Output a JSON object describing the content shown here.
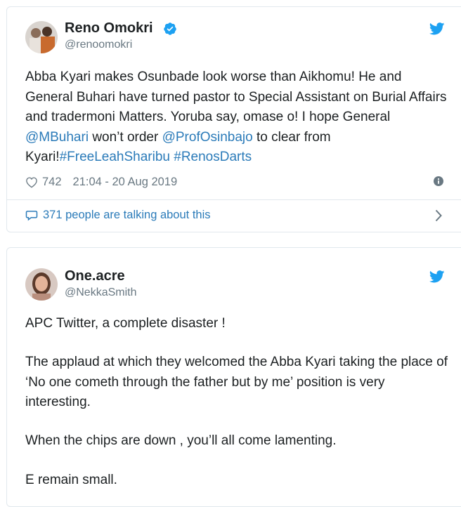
{
  "tweet1": {
    "display_name": "Reno Omokri",
    "handle": "@renoomokri",
    "text_parts": {
      "a": "Abba Kyari makes Osunbade look worse than Aikhomu! He and General Buhari have turned pastor to Special Assistant on Burial Affairs and tradermoni Matters. Yoruba say, omase o! I hope General ",
      "mention1": "@MBuhari",
      "b": " won’t order ",
      "mention2": "@ProfOsinbajo",
      "c": " to clear from Kyari!",
      "tag1": "#FreeLeahSharibu",
      "space": " ",
      "tag2": "#RenosDarts"
    },
    "likes": "742",
    "timestamp": "21:04 - 20 Aug 2019",
    "talking": "371 people are talking about this"
  },
  "tweet2": {
    "display_name": "One.acre",
    "handle": "@NekkaSmith",
    "paragraphs": [
      "APC Twitter, a complete disaster !",
      "The applaud at which they welcomed the Abba Kyari taking the place of ‘No one cometh through the father but by me’ position is very interesting.",
      "When the chips are down , you’ll all come lamenting.",
      "E remain small."
    ]
  },
  "colors": {
    "link": "#2b7bb9",
    "twitter_blue": "#1da1f2",
    "muted": "#697882",
    "border": "#e1e8ed"
  },
  "icons": [
    "verified-badge-icon",
    "twitter-bird-icon",
    "heart-icon",
    "info-icon",
    "speech-bubble-icon",
    "chevron-right-icon"
  ]
}
